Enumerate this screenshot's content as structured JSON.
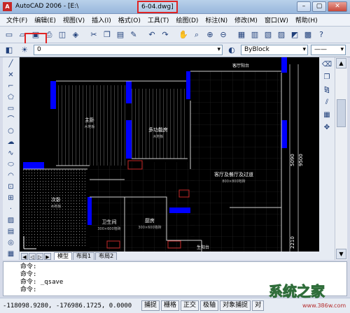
{
  "window": {
    "app_title": "AutoCAD 2006 - [E:\\",
    "file_name": "6-04.dwg]",
    "controls": [
      "–",
      "▢",
      "✕"
    ]
  },
  "menu": [
    "文件(F)",
    "编辑(E)",
    "视图(V)",
    "插入(I)",
    "格式(O)",
    "工具(T)",
    "绘图(D)",
    "标注(N)",
    "修改(M)",
    "窗口(W)",
    "帮助(H)"
  ],
  "toolbar": {
    "layer_value": "0",
    "color_value": "ByBlock",
    "linetype_value": "——"
  },
  "drawing": {
    "rooms": {
      "master_bedroom": "主卧",
      "multi_room": "多功能房",
      "living": "客厅及餐厅及过道",
      "second_bedroom": "次卧",
      "bathroom": "卫生间",
      "kitchen": "厨房",
      "balcony": "生阳台",
      "top_label": "客厅阳台"
    },
    "subtitles": {
      "bed": "木地板",
      "multi": "木地板",
      "living": "800×800地砖",
      "second": "木地板",
      "bath": "300×600墙砖",
      "kitchen": "300×600墙砖"
    },
    "dims": {
      "d1": "5090",
      "d2": "9500",
      "d3": "2210"
    }
  },
  "tabs": {
    "model": "模型",
    "layout1": "布局1",
    "layout2": "布局2"
  },
  "command_lines": [
    "命令:",
    "命令:",
    "命令: _qsave",
    "命令:"
  ],
  "status": {
    "coords": "-118098.9280, -176986.1725, 0.0000",
    "buttons": [
      "捕捉",
      "栅格",
      "正交",
      "极轴",
      "对象捕捉",
      "对"
    ]
  },
  "watermark": {
    "text": "系统之家",
    "url": "www.386w.com"
  }
}
